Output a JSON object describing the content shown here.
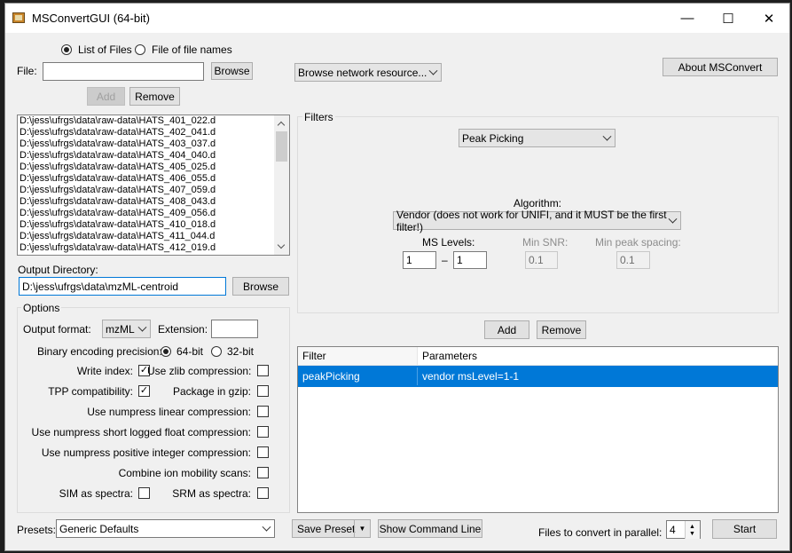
{
  "window": {
    "title": "MSConvertGUI (64-bit)",
    "minimize_glyph": "—",
    "maximize_glyph": "☐",
    "close_glyph": "✕"
  },
  "source": {
    "radio_list": "List of Files",
    "radio_file": "File of file names",
    "selected": "list",
    "file_label": "File:",
    "file_value": "",
    "browse": "Browse",
    "add": "Add",
    "remove": "Remove",
    "network_combo": "Browse network resource...",
    "about": "About MSConvert"
  },
  "files": [
    "D:\\jess\\ufrgs\\data\\raw-data\\HATS_401_022.d",
    "D:\\jess\\ufrgs\\data\\raw-data\\HATS_402_041.d",
    "D:\\jess\\ufrgs\\data\\raw-data\\HATS_403_037.d",
    "D:\\jess\\ufrgs\\data\\raw-data\\HATS_404_040.d",
    "D:\\jess\\ufrgs\\data\\raw-data\\HATS_405_025.d",
    "D:\\jess\\ufrgs\\data\\raw-data\\HATS_406_055.d",
    "D:\\jess\\ufrgs\\data\\raw-data\\HATS_407_059.d",
    "D:\\jess\\ufrgs\\data\\raw-data\\HATS_408_043.d",
    "D:\\jess\\ufrgs\\data\\raw-data\\HATS_409_056.d",
    "D:\\jess\\ufrgs\\data\\raw-data\\HATS_410_018.d",
    "D:\\jess\\ufrgs\\data\\raw-data\\HATS_411_044.d",
    "D:\\jess\\ufrgs\\data\\raw-data\\HATS_412_019.d"
  ],
  "output": {
    "label": "Output Directory:",
    "value": "D:\\jess\\ufrgs\\data\\mzML-centroid",
    "browse": "Browse"
  },
  "options": {
    "group_title": "Options",
    "format_label": "Output format:",
    "format_value": "mzML",
    "extension_label": "Extension:",
    "extension_value": "",
    "precision_label": "Binary encoding precision:",
    "precision_64": "64-bit",
    "precision_32": "32-bit",
    "precision_selected": "64-bit",
    "write_index": "Write index:",
    "write_index_checked": true,
    "zlib": "Use zlib compression:",
    "zlib_checked": false,
    "tpp": "TPP compatibility:",
    "tpp_checked": true,
    "gzip": "Package in gzip:",
    "gzip_checked": false,
    "numpress_linear": "Use numpress linear compression:",
    "numpress_linear_checked": false,
    "numpress_slof": "Use numpress short logged float compression:",
    "numpress_slof_checked": false,
    "numpress_pic": "Use numpress positive integer compression:",
    "numpress_pic_checked": false,
    "ion_mobility": "Combine ion mobility scans:",
    "ion_mobility_checked": false,
    "sim": "SIM as spectra:",
    "sim_checked": false,
    "srm": "SRM as spectra:",
    "srm_checked": false
  },
  "filters": {
    "group_title": "Filters",
    "filter_combo": "Peak Picking",
    "algorithm_label": "Algorithm:",
    "algorithm_value": "Vendor (does not work for UNIFI, and it MUST be the first filter!)",
    "ms_levels_label": "MS Levels:",
    "ms_level_from": "1",
    "ms_level_dash": "–",
    "ms_level_to": "1",
    "min_snr_label": "Min SNR:",
    "min_snr_value": "0.1",
    "min_peak_label": "Min peak spacing:",
    "min_peak_value": "0.1",
    "add": "Add",
    "remove": "Remove",
    "table_headers": [
      "Filter",
      "Parameters"
    ],
    "rows": [
      {
        "filter": "peakPicking",
        "parameters": "vendor msLevel=1-1"
      }
    ]
  },
  "bottom": {
    "presets_label": "Presets:",
    "presets_value": "Generic Defaults",
    "save_preset": "Save Preset",
    "show_command_line": "Show Command Line",
    "parallel_label": "Files to convert in parallel:",
    "parallel_value": "4",
    "start": "Start"
  },
  "colors": {
    "selection": "#0078d7",
    "window_bg": "#f0f0f0"
  }
}
